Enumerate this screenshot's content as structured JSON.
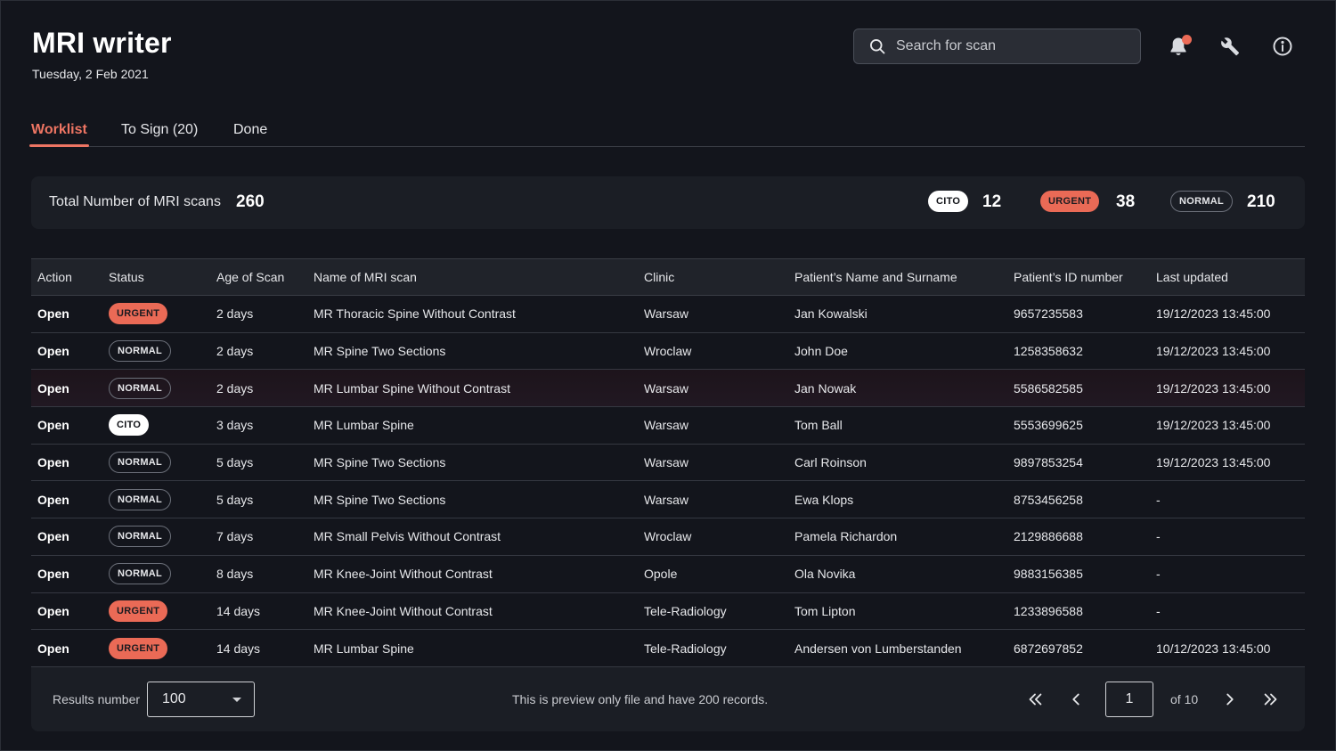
{
  "header": {
    "title": "MRI writer",
    "date": "Tuesday, 2 Feb 2021",
    "search_placeholder": "Search for scan",
    "notification_dot_color": "#ec6b57"
  },
  "tabs": [
    {
      "label": "Worklist",
      "active": true
    },
    {
      "label": "To Sign (20)",
      "active": false
    },
    {
      "label": "Done",
      "active": false
    }
  ],
  "summary": {
    "label": "Total Number of MRI scans",
    "total": "260",
    "counts": [
      {
        "badge": "CITO",
        "count": "12"
      },
      {
        "badge": "URGENT",
        "count": "38"
      },
      {
        "badge": "NORMAL",
        "count": "210"
      }
    ]
  },
  "table": {
    "columns": [
      "Action",
      "Status",
      "Age of Scan",
      "Name of MRI scan",
      "Clinic",
      "Patient’s Name and Surname",
      "Patient’s ID number",
      "Last updated"
    ],
    "rows": [
      {
        "action": "Open",
        "status": "URGENT",
        "age": "2 days",
        "scan": "MR Thoracic Spine Without Contrast",
        "clinic": "Warsaw",
        "patient": "Jan Kowalski",
        "id": "9657235583",
        "updated": "19/12/2023 13:45:00"
      },
      {
        "action": "Open",
        "status": "NORMAL",
        "age": "2 days",
        "scan": "MR Spine Two Sections",
        "clinic": "Wroclaw",
        "patient": "John Doe",
        "id": "1258358632",
        "updated": "19/12/2023 13:45:00"
      },
      {
        "action": "Open",
        "status": "NORMAL",
        "age": "2 days",
        "scan": "MR Lumbar Spine Without Contrast",
        "clinic": "Warsaw",
        "patient": "Jan Nowak",
        "id": "5586582585",
        "updated": "19/12/2023 13:45:00",
        "highlighted": true
      },
      {
        "action": "Open",
        "status": "CITO",
        "age": "3 days",
        "scan": "MR Lumbar Spine",
        "clinic": "Warsaw",
        "patient": "Tom Ball",
        "id": "5553699625",
        "updated": "19/12/2023 13:45:00"
      },
      {
        "action": "Open",
        "status": "NORMAL",
        "age": "5 days",
        "scan": "MR Spine Two Sections",
        "clinic": "Warsaw",
        "patient": "Carl Roinson",
        "id": "9897853254",
        "updated": "19/12/2023 13:45:00"
      },
      {
        "action": "Open",
        "status": "NORMAL",
        "age": "5 days",
        "scan": "MR Spine Two Sections",
        "clinic": "Warsaw",
        "patient": "Ewa Klops",
        "id": "8753456258",
        "updated": "-"
      },
      {
        "action": "Open",
        "status": "NORMAL",
        "age": "7 days",
        "scan": "MR Small Pelvis Without Contrast",
        "clinic": "Wroclaw",
        "patient": "Pamela Richardon",
        "id": "2129886688",
        "updated": "-"
      },
      {
        "action": "Open",
        "status": "NORMAL",
        "age": "8 days",
        "scan": "MR Knee-Joint Without Contrast",
        "clinic": "Opole",
        "patient": "Ola Novika",
        "id": "9883156385",
        "updated": "-"
      },
      {
        "action": "Open",
        "status": "URGENT",
        "age": "14 days",
        "scan": "MR Knee-Joint Without Contrast",
        "clinic": "Tele-Radiology",
        "patient": "Tom Lipton",
        "id": "1233896588",
        "updated": "-"
      },
      {
        "action": "Open",
        "status": "URGENT",
        "age": "14 days",
        "scan": "MR Lumbar Spine",
        "clinic": "Tele-Radiology",
        "patient": "Andersen von Lumberstanden",
        "id": "6872697852",
        "updated": "10/12/2023 13:45:00"
      }
    ]
  },
  "footer": {
    "results_label": "Results number",
    "results_value": "100",
    "preview_note": "This is preview only file and have 200 records.",
    "page": "1",
    "page_of": "of 10"
  },
  "colors": {
    "background": "#13151c",
    "accent": "#ee7563",
    "urgent": "#ea6a56",
    "cito": "#ffffff"
  },
  "icons": [
    "search-icon",
    "bell-icon",
    "wrench-icon",
    "info-icon",
    "first-page-icon",
    "prev-page-icon",
    "next-page-icon",
    "last-page-icon",
    "chevron-down-icon"
  ]
}
